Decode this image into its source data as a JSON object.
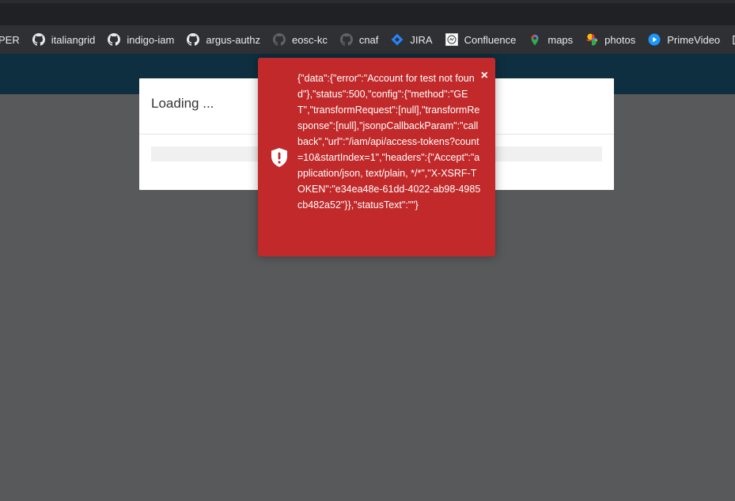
{
  "bookmarks": [
    {
      "label": "PER",
      "icon": "folder-icon"
    },
    {
      "label": "italiangrid",
      "icon": "github-icon"
    },
    {
      "label": "indigo-iam",
      "icon": "github-icon"
    },
    {
      "label": "argus-authz",
      "icon": "github-icon"
    },
    {
      "label": "eosc-kc",
      "icon": "github-icon-dim"
    },
    {
      "label": "cnaf",
      "icon": "github-icon-dim"
    },
    {
      "label": "JIRA",
      "icon": "jira-icon"
    },
    {
      "label": "Confluence",
      "icon": "confluence-icon"
    },
    {
      "label": "maps",
      "icon": "maps-pin-icon"
    },
    {
      "label": "photos",
      "icon": "photos-pinwheel-icon"
    },
    {
      "label": "PrimeVideo",
      "icon": "play-icon"
    }
  ],
  "colors": {
    "browser_bg": "#202124",
    "bookmarks_bg": "#2f3033",
    "app_header": "#0d2f3f",
    "page_bg": "#58595b",
    "toast_error": "#c1292a"
  },
  "loading": {
    "title": "Loading ..."
  },
  "toast": {
    "message": "{\"data\":{\"error\":\"Account for test not found\"},\"status\":500,\"config\":{\"method\":\"GET\",\"transformRequest\":[null],\"transformResponse\":[null],\"jsonpCallbackParam\":\"callback\",\"url\":\"/iam/api/access-tokens?count=10&startIndex=1\",\"headers\":{\"Accept\":\"application/json, text/plain, */*\",\"X-XSRF-TOKEN\":\"e34ea48e-61dd-4022-ab98-4985cb482a52\"}},\"statusText\":\"\"}",
    "close_label": "×",
    "icon": "shield-alert-icon"
  }
}
